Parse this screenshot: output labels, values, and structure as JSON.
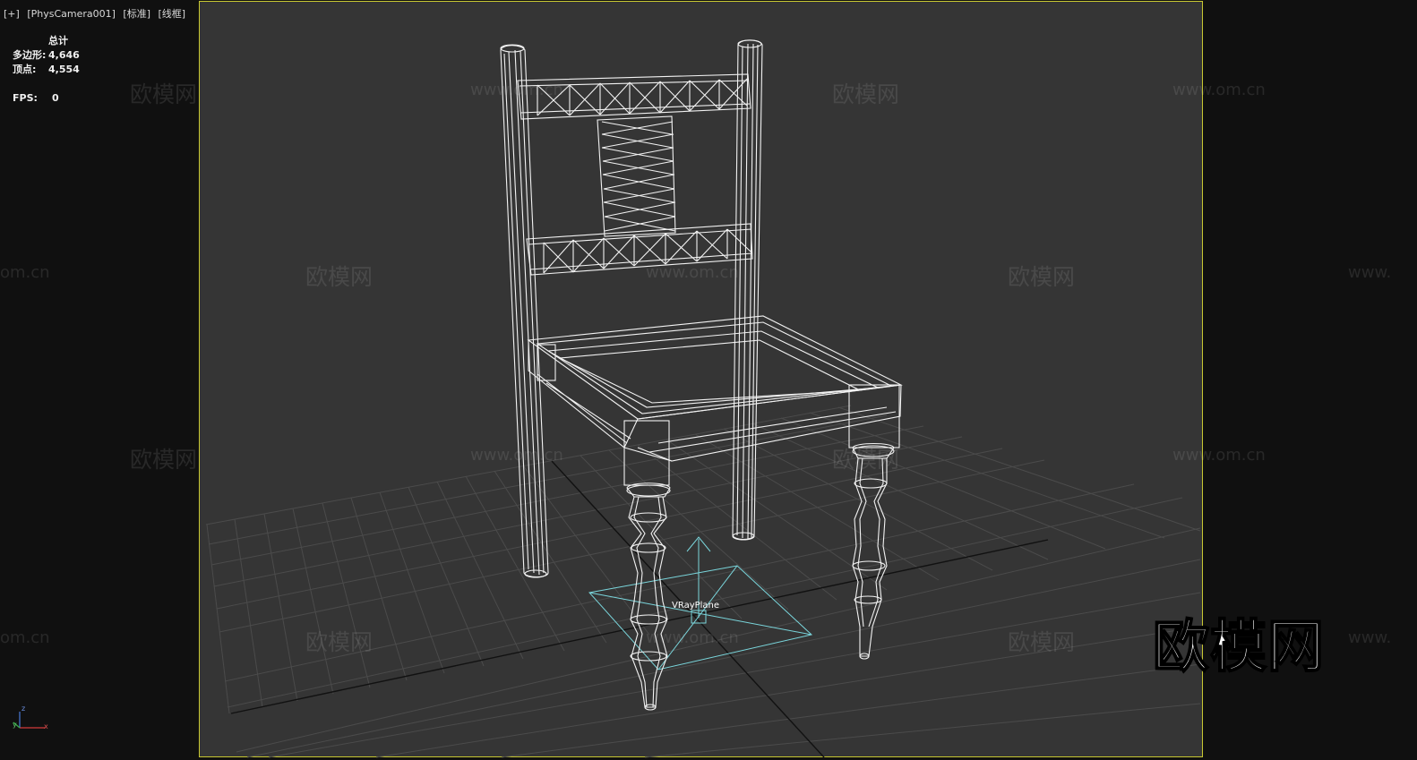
{
  "viewport": {
    "label_parts": [
      "[+]",
      "[PhysCamera001]",
      "[标准]",
      "[线框]"
    ]
  },
  "stats": {
    "total_label": "总计",
    "polygons_label": "多边形:",
    "polygons_value": "4,646",
    "vertices_label": "顶点:",
    "vertices_value": "4,554",
    "fps_label": "FPS:",
    "fps_value": "0"
  },
  "scene": {
    "object_label": "VRayPlane",
    "wireframe_color": "#ffffff",
    "helper_color": "#7ad6dc",
    "safe_frame_color": "#c8c832",
    "viewport_bg": "#353535"
  },
  "watermarks": {
    "cn_text": "欧模网",
    "url_text": "www.om.cn",
    "url_partial_left": "om.cn",
    "url_partial_right": "www.",
    "brand_text": "欧模网"
  },
  "axis": {
    "x": "x",
    "y": "y",
    "z": "z"
  }
}
